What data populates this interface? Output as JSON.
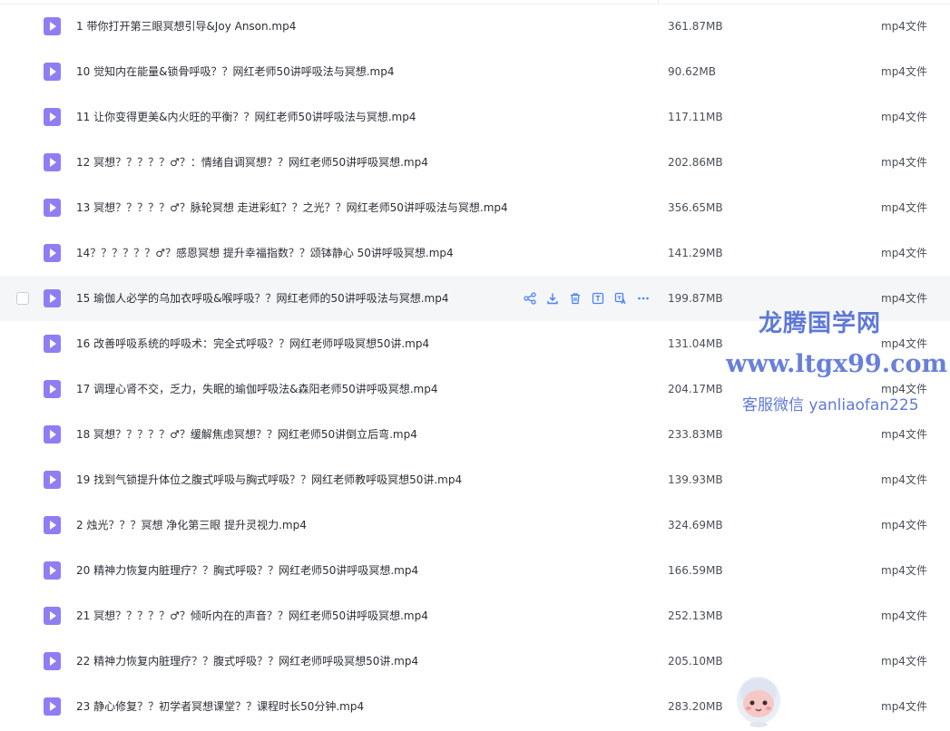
{
  "files": [
    {
      "name": "1 带你打开第三眼冥想引导&Joy Anson.mp4",
      "size": "361.87MB",
      "type": "mp4文件"
    },
    {
      "name": "10 觉知内在能量&锁骨呼吸？？网红老师50讲呼吸法与冥想.mp4",
      "size": "90.62MB",
      "type": "mp4文件"
    },
    {
      "name": "11 让你变得更美&内火旺的平衡？？网红老师50讲呼吸法与冥想.mp4",
      "size": "117.11MB",
      "type": "mp4文件"
    },
    {
      "name": "12 冥想？？？？？♂？：情绪自调冥想？？网红老师50讲呼吸冥想.mp4",
      "size": "202.86MB",
      "type": "mp4文件"
    },
    {
      "name": "13 冥想？？？？？♂？脉轮冥想 走进彩虹？？之光？？网红老师50讲呼吸法与冥想.mp4",
      "size": "356.65MB",
      "type": "mp4文件"
    },
    {
      "name": "14？？？？？？♂？感恩冥想 提升幸福指数？？颂钵静心 50讲呼吸冥想.mp4",
      "size": "141.29MB",
      "type": "mp4文件"
    },
    {
      "name": "15 瑜伽人必学的乌加衣呼吸&喉呼吸？？网红老师的50讲呼吸法与冥想.mp4",
      "size": "199.87MB",
      "type": "mp4文件",
      "hover": true
    },
    {
      "name": "16 改善呼吸系统的呼吸术：完全式呼吸？？网红老师呼吸冥想50讲.mp4",
      "size": "131.04MB",
      "type": "mp4文件"
    },
    {
      "name": "17 调理心肾不交，乏力，失眠的瑜伽呼吸法&森阳老师50讲呼吸冥想.mp4",
      "size": "204.17MB",
      "type": "mp4文件"
    },
    {
      "name": "18 冥想？？？？？♂？缓解焦虑冥想？？网红老师50讲倒立后弯.mp4",
      "size": "233.83MB",
      "type": "mp4文件"
    },
    {
      "name": "19 找到气锁提升体位之腹式呼吸与胸式呼吸？？网红老师教呼吸冥想50讲.mp4",
      "size": "139.93MB",
      "type": "mp4文件"
    },
    {
      "name": "2 烛光？？？冥想 净化第三眼 提升灵视力.mp4",
      "size": "324.69MB",
      "type": "mp4文件"
    },
    {
      "name": "20 精神力恢复内脏理疗？？胸式呼吸？？网红老师50讲呼吸冥想.mp4",
      "size": "166.59MB",
      "type": "mp4文件"
    },
    {
      "name": "21 冥想？？？？？♂？倾听内在的声音？？网红老师50讲呼吸冥想.mp4",
      "size": "252.13MB",
      "type": "mp4文件"
    },
    {
      "name": "22 精神力恢复内脏理疗？？腹式呼吸？？网红老师呼吸冥想50讲.mp4",
      "size": "205.10MB",
      "type": "mp4文件"
    },
    {
      "name": "23 静心修复？？初学者冥想课堂？？课程时长50分钟.mp4",
      "size": "283.20MB",
      "type": "mp4文件"
    }
  ],
  "row_actions": [
    "share-icon",
    "download-icon",
    "delete-icon",
    "text-extract-icon",
    "translate-icon",
    "more-icon"
  ],
  "watermark": {
    "line1": "龙腾国学网",
    "line2": "www.ltgx99.com",
    "line3": "客服微信 yanliaofan225"
  },
  "colors": {
    "file_icon": "#8f7ef3",
    "action_icon": "#4c82f7",
    "watermark": "#4e6bd4"
  }
}
